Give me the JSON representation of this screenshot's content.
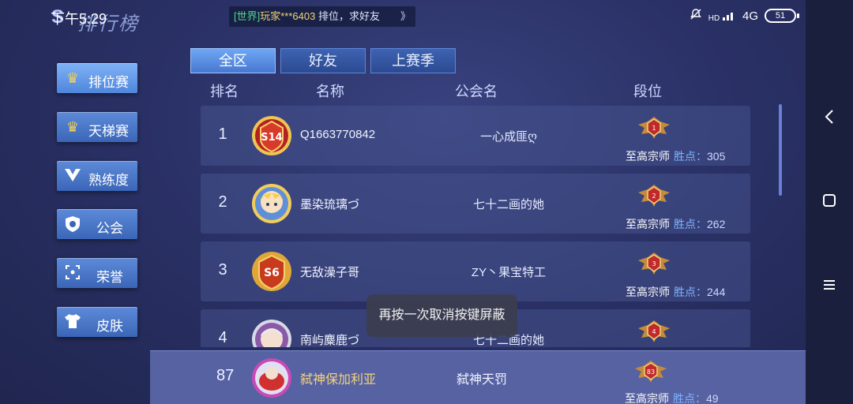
{
  "status": {
    "time": "下午5:29",
    "network": "4G",
    "battery": "51",
    "signal_label": "HD"
  },
  "header": {
    "title": "排行榜",
    "logo_mark": "S"
  },
  "ticker": {
    "channel": "[世界]",
    "player": "玩家***6403",
    "message": " 排位，求好友",
    "arrow": "》"
  },
  "sidebar": {
    "items": [
      {
        "label": "排位赛",
        "icon": "crown-icon"
      },
      {
        "label": "天梯赛",
        "icon": "crown-icon"
      },
      {
        "label": "熟练度",
        "icon": "v-badge-icon"
      },
      {
        "label": "公会",
        "icon": "shield-icon"
      },
      {
        "label": "荣誉",
        "icon": "target-icon"
      },
      {
        "label": "皮肤",
        "icon": "shirt-icon"
      }
    ]
  },
  "tabs": [
    {
      "label": "全区"
    },
    {
      "label": "好友"
    },
    {
      "label": "上赛季"
    }
  ],
  "columns": {
    "rank": "排名",
    "name": "名称",
    "guild": "公会名",
    "tier": "段位"
  },
  "rows": [
    {
      "rank": "1",
      "name": "Q1663770842",
      "guild": "一心成匪ღ",
      "badge": "1",
      "tier": "至高宗师",
      "points_label": "胜点：",
      "points": "305"
    },
    {
      "rank": "2",
      "name": "墨染琉璃づ",
      "guild": "七十二画的她",
      "badge": "2",
      "tier": "至高宗师",
      "points_label": "胜点：",
      "points": "262"
    },
    {
      "rank": "3",
      "name": "无敌澡子哥",
      "guild": "ZY丶果宝特工",
      "badge": "3",
      "tier": "至高宗师",
      "points_label": "胜点：",
      "points": "244"
    },
    {
      "rank": "4",
      "name": "南屿麋鹿づ",
      "guild": "七十二画的她",
      "badge": "4",
      "tier": "",
      "points_label": "",
      "points": ""
    }
  ],
  "my_row": {
    "rank": "87",
    "name": "弑神保加利亚",
    "guild": "弑神天罚",
    "badge": "83",
    "tier": "至高宗师",
    "points_label": "胜点：",
    "points": "49"
  },
  "toast": {
    "text": "再按一次取消按键屏蔽"
  },
  "nav": {
    "back": "‹",
    "home": "□",
    "menu": "≡"
  },
  "colors": {
    "accent": "#4f86dc",
    "highlight_name": "#f4d37a",
    "points_label": "#7fb3ff"
  }
}
